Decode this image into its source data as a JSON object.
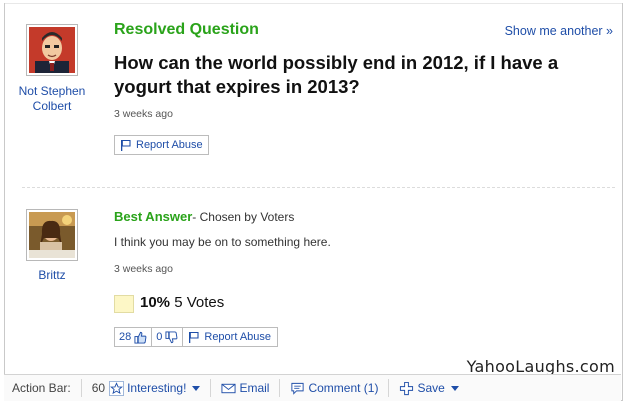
{
  "question": {
    "status": "Resolved Question",
    "show_another": "Show me another »",
    "text": "How can the world possibly end in 2012, if I have a yogurt that expires in 2013?",
    "asker": "Not Stephen Colbert",
    "time": "3 weeks ago",
    "report_label": "Report Abuse"
  },
  "answer": {
    "heading": "Best Answer",
    "chosen_by": " - Chosen by Voters",
    "text": "I think you may be on to something here.",
    "author": "Brittz",
    "time": "3 weeks ago",
    "vote_percent": "10%",
    "vote_count": "5 Votes",
    "thumbs_up": "28",
    "thumbs_down": "0",
    "report_label": "Report Abuse"
  },
  "watermark": "YahooLaughs.com",
  "action_bar": {
    "label": "Action Bar:",
    "interesting_count": "60",
    "interesting_label": "Interesting!",
    "email_label": "Email",
    "comment_label": "Comment (1)",
    "save_label": "Save"
  },
  "colors": {
    "green": "#2aa31a",
    "link": "#1f4ea8",
    "vote_box": "#fdf7c6"
  }
}
